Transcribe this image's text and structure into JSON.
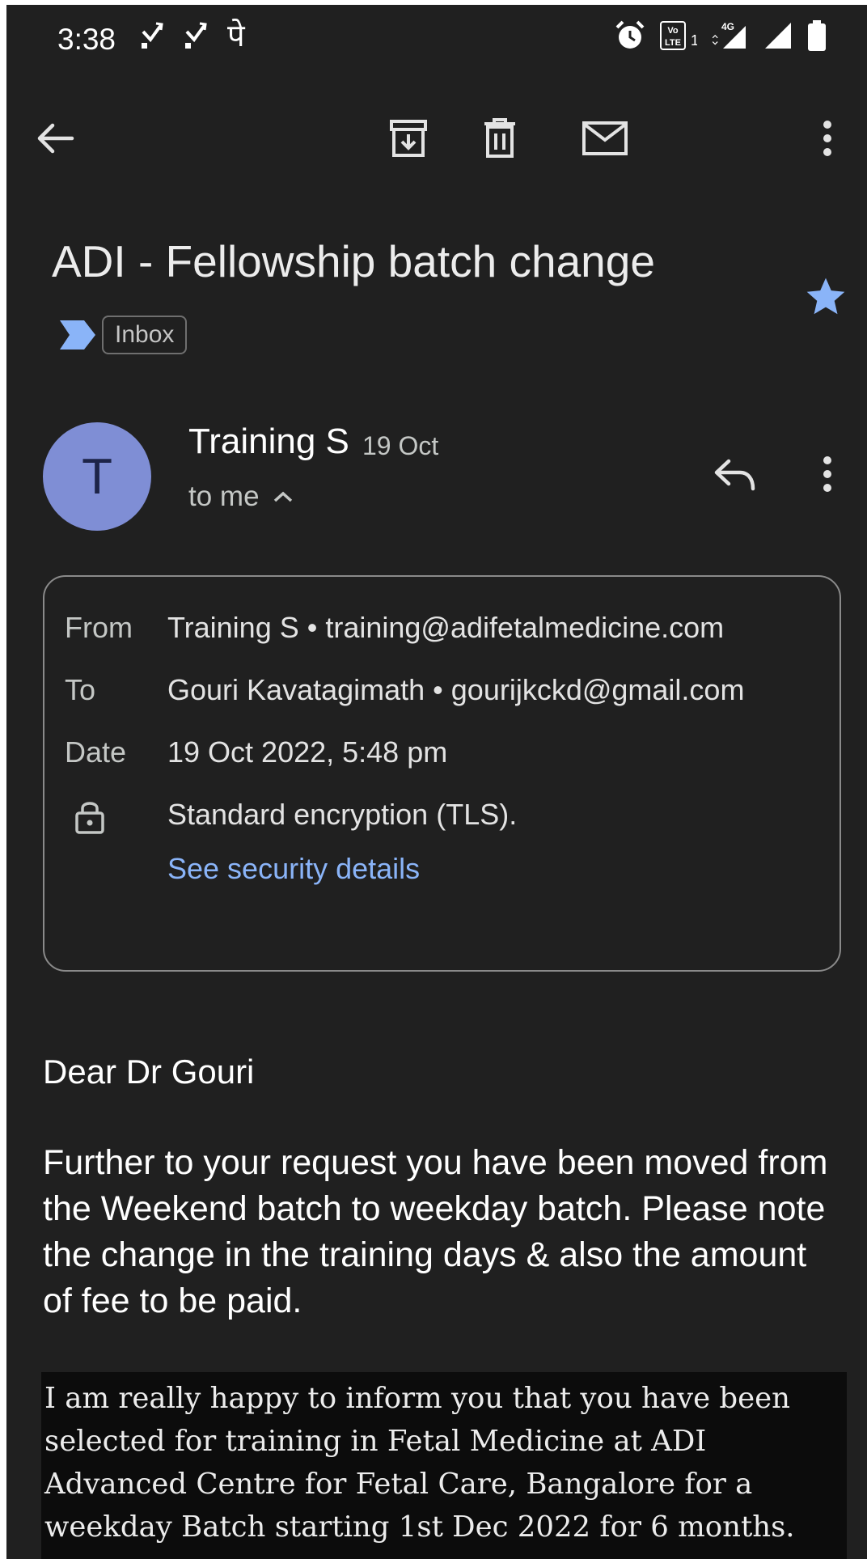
{
  "status_bar": {
    "time": "3:38",
    "notif_glyph": "पे",
    "icons": [
      "missed-call-icon",
      "missed-call-icon",
      "paytm-icon",
      "alarm-icon",
      "volte-icon",
      "signal-4g-icon",
      "signal-icon",
      "battery-icon"
    ]
  },
  "toolbar": {
    "icons": [
      "back-arrow-icon",
      "archive-icon",
      "delete-icon",
      "mark-unread-icon",
      "more-vert-icon"
    ]
  },
  "email": {
    "subject": "ADI - Fellowship batch change",
    "label": "Inbox",
    "starred": true,
    "star_color": "#8ab4f8",
    "important_color": "#8ab4f8",
    "sender": {
      "initial": "T",
      "name": "Training S",
      "date": "19 Oct",
      "recipient_summary": "to me",
      "avatar_color": "#7f8ed5"
    },
    "details": {
      "from_label": "From",
      "from_value": "Training S • training@adifetalmedicine.com",
      "to_label": "To",
      "to_value": "Gouri Kavatagimath • gourijkckd@gmail.com",
      "date_label": "Date",
      "date_value": "19 Oct 2022, 5:48 pm",
      "encryption": "Standard encryption (TLS).",
      "security_link": "See security details"
    },
    "body": {
      "greeting": "Dear Dr Gouri",
      "paragraph": "Further to your request you have been moved from the Weekend batch to weekday batch. Please note the change in the training days & also the amount of fee to be paid.",
      "quoted_lines": [
        "I am really happy to inform you that you have been",
        "selected for training in Fetal Medicine at ADI",
        "Advanced Centre for Fetal Care, Bangalore for a",
        "weekday Batch starting 1st Dec 2022 for 6 months."
      ]
    }
  },
  "theme": {
    "background": "#202020",
    "link": "#8ab4f8"
  }
}
